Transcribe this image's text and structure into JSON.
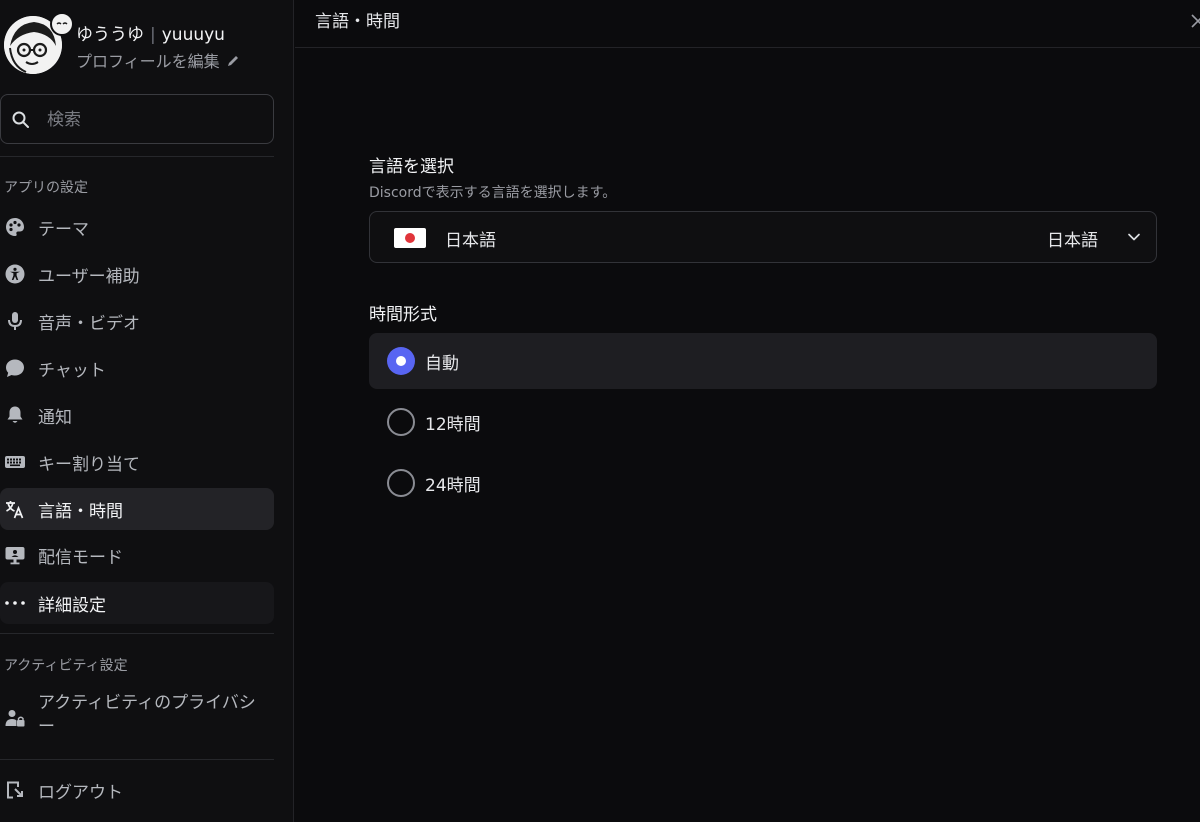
{
  "profile": {
    "display_name": "ゆううゆ",
    "separator": "|",
    "username": "yuuuyu",
    "edit_label": "プロフィールを編集"
  },
  "search": {
    "placeholder": "検索"
  },
  "sidebar": {
    "app_settings_title": "アプリの設定",
    "items": [
      {
        "label": "テーマ",
        "icon": "palette-icon"
      },
      {
        "label": "ユーザー補助",
        "icon": "accessibility-icon"
      },
      {
        "label": "音声・ビデオ",
        "icon": "microphone-icon"
      },
      {
        "label": "チャット",
        "icon": "chat-bubble-icon"
      },
      {
        "label": "通知",
        "icon": "bell-icon"
      },
      {
        "label": "キー割り当て",
        "icon": "keyboard-icon"
      },
      {
        "label": "言語・時間",
        "icon": "translate-icon"
      },
      {
        "label": "配信モード",
        "icon": "streamer-icon"
      },
      {
        "label": "詳細設定",
        "icon": "more-dots-icon"
      }
    ],
    "activity_title": "アクティビティ設定",
    "activity_items": [
      {
        "label": "アクティビティのプライバシー",
        "icon": "activity-privacy-icon"
      }
    ],
    "logout_label": "ログアウト"
  },
  "main": {
    "title": "言語・時間",
    "language": {
      "heading": "言語を選択",
      "description": "Discordで表示する言語を選択します。",
      "selected": "日本語",
      "selected_native": "日本語"
    },
    "time_format": {
      "heading": "時間形式",
      "options": [
        {
          "label": "自動",
          "selected": true
        },
        {
          "label": "12時間",
          "selected": false
        },
        {
          "label": "24時間",
          "selected": false
        }
      ]
    }
  },
  "colors": {
    "accent": "#5865f2",
    "background": "#0b0b0d",
    "sidebar": "#0f0f11",
    "active_item": "#232327"
  }
}
